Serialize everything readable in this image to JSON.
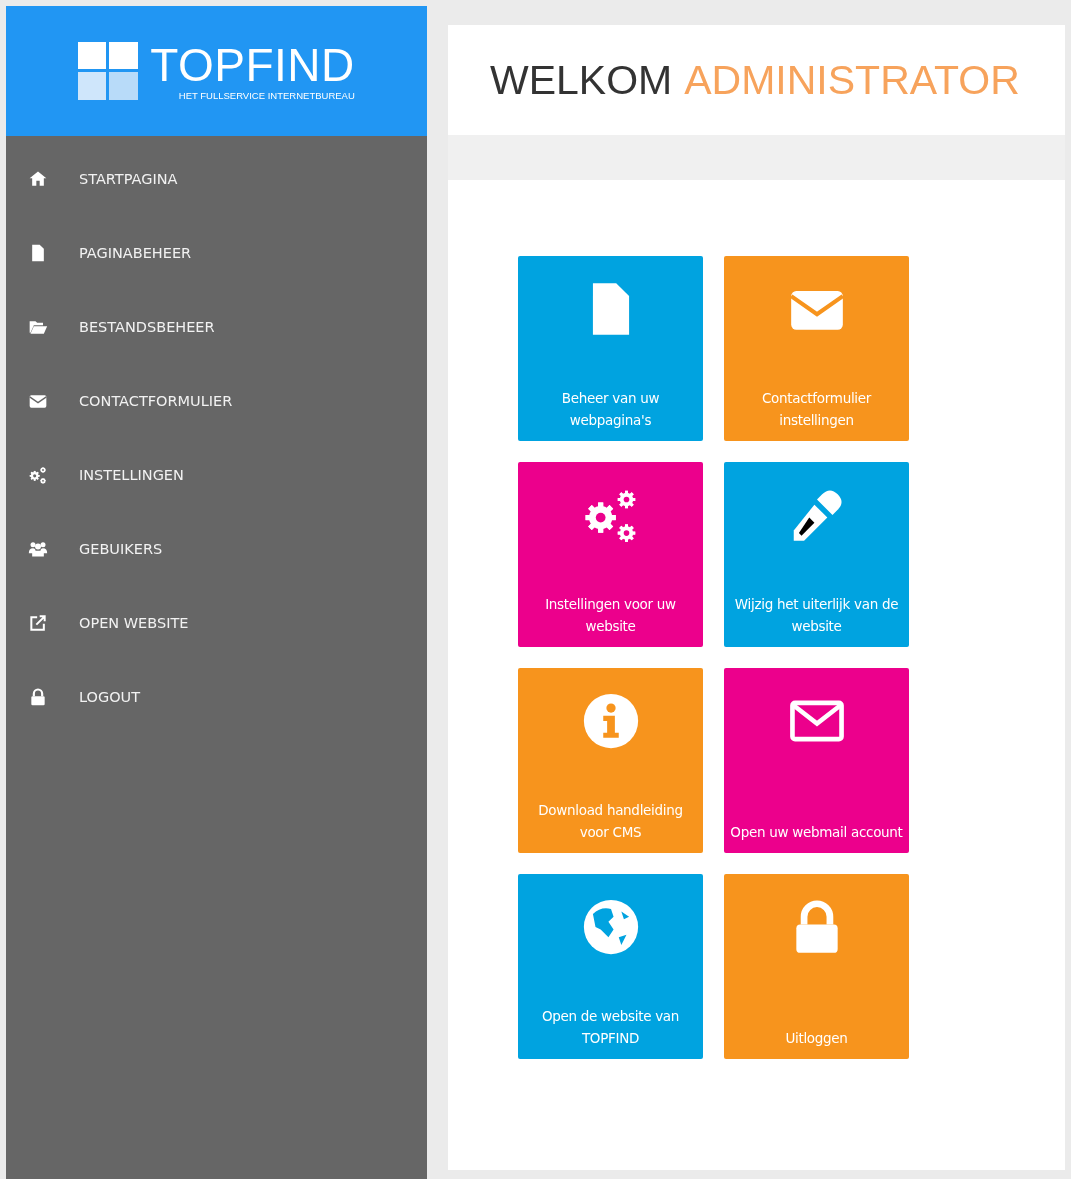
{
  "logo": {
    "name": "TOPFIND",
    "tagline": "HET FULLSERVICE INTERNETBUREAU"
  },
  "sidebar": {
    "items": [
      {
        "label": "STARTPAGINA"
      },
      {
        "label": "PAGINABEHEER"
      },
      {
        "label": "BESTANDSBEHEER"
      },
      {
        "label": "CONTACTFORMULIER"
      },
      {
        "label": "INSTELLINGEN"
      },
      {
        "label": "GEBUIKERS"
      },
      {
        "label": "OPEN WEBSITE"
      },
      {
        "label": "LOGOUT"
      }
    ]
  },
  "header": {
    "greeting": "WELKOM",
    "name": "ADMINISTRATOR"
  },
  "tiles": [
    {
      "label": "Beheer van uw webpagina's",
      "color": "#00a3e0"
    },
    {
      "label": "Contactformulier instellingen",
      "color": "#f7941d"
    },
    {
      "label": "Instellingen voor uw website",
      "color": "#ec008c"
    },
    {
      "label": "Wijzig het uiterlijk van de website",
      "color": "#00a3e0"
    },
    {
      "label": "Download handleiding voor CMS",
      "color": "#f7941d"
    },
    {
      "label": "Open uw webmail account",
      "color": "#ec008c"
    },
    {
      "label": "Open de website van TOPFIND",
      "color": "#00a3e0"
    },
    {
      "label": "Uitloggen",
      "color": "#f7941d"
    }
  ]
}
